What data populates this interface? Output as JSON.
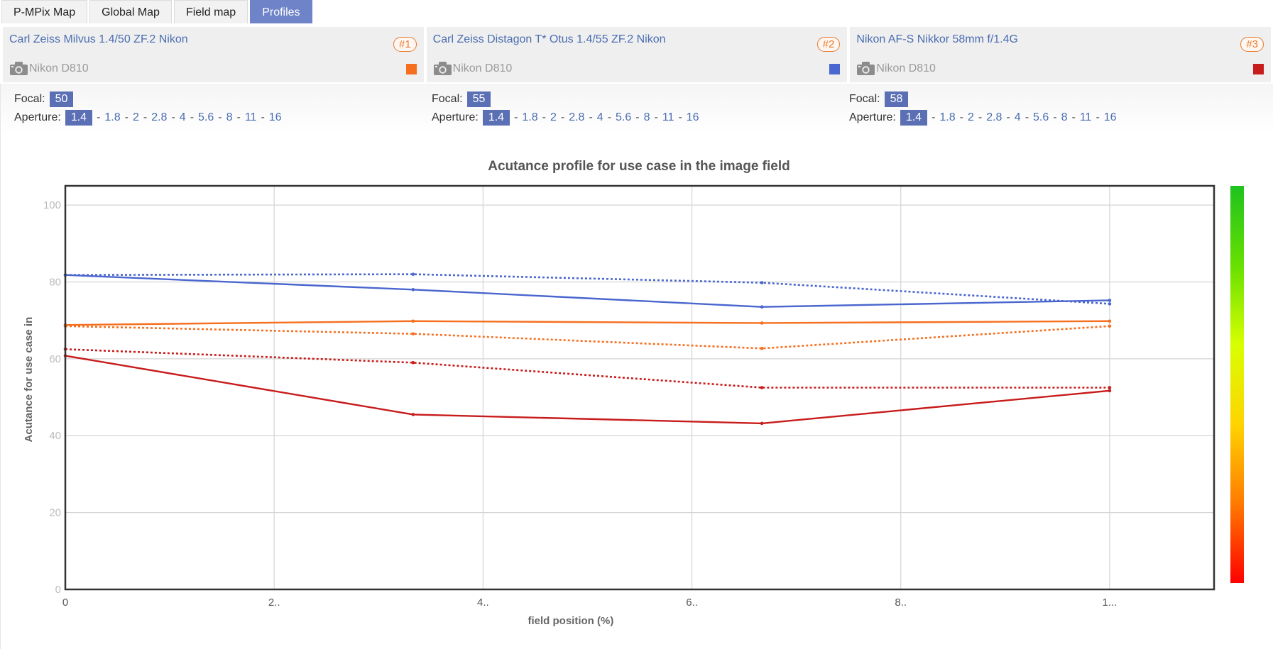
{
  "tabs": [
    {
      "label": "P-MPix Map",
      "active": false
    },
    {
      "label": "Global Map",
      "active": false
    },
    {
      "label": "Field map",
      "active": false
    },
    {
      "label": "Profiles",
      "active": true
    }
  ],
  "lenses": [
    {
      "name": "Carl Zeiss Milvus 1.4/50 ZF.2 Nikon",
      "badge": "#1",
      "camera": "Nikon D810",
      "color": "#f56f1f",
      "focal_label": "Focal:",
      "focal": "50",
      "aperture_label": "Aperture:",
      "aperture_selected": "1.4",
      "apertures": [
        "1.8",
        "2",
        "2.8",
        "4",
        "5.6",
        "8",
        "11",
        "16"
      ]
    },
    {
      "name": "Carl Zeiss Distagon T* Otus 1.4/55 ZF.2 Nikon",
      "badge": "#2",
      "camera": "Nikon D810",
      "color": "#4a66cf",
      "focal_label": "Focal:",
      "focal": "55",
      "aperture_label": "Aperture:",
      "aperture_selected": "1.4",
      "apertures": [
        "1.8",
        "2",
        "2.8",
        "4",
        "5.6",
        "8",
        "11",
        "16"
      ]
    },
    {
      "name": "Nikon AF-S Nikkor 58mm f/1.4G",
      "badge": "#3",
      "camera": "Nikon D810",
      "color": "#c81b1b",
      "focal_label": "Focal:",
      "focal": "58",
      "aperture_label": "Aperture:",
      "aperture_selected": "1.4",
      "apertures": [
        "1.8",
        "2",
        "2.8",
        "4",
        "5.6",
        "8",
        "11",
        "16"
      ]
    }
  ],
  "chart_data": {
    "type": "line",
    "title": "Acutance profile for use case in the image field",
    "xlabel": "field position (%)",
    "ylabel": "Acutance for use case in",
    "xlim": [
      0,
      110
    ],
    "ylim": [
      0,
      105
    ],
    "xticks": [
      0,
      20,
      40,
      60,
      80,
      100
    ],
    "xtick_labels": [
      "0",
      "2..",
      "4..",
      "6..",
      "8..",
      "1..."
    ],
    "yticks": [
      0,
      20,
      40,
      60,
      80,
      100
    ],
    "ytick_labels": [
      "0",
      "20",
      "40",
      "60",
      "80",
      "100"
    ],
    "grid": true,
    "x": [
      0,
      33.3,
      66.7,
      100
    ],
    "series": [
      {
        "color": "#4a66cf",
        "style": "solid",
        "values": [
          81.8,
          78,
          73.5,
          75.2
        ]
      },
      {
        "color": "#4a66cf",
        "style": "dotted",
        "values": [
          81.8,
          82,
          79.8,
          74.3
        ]
      },
      {
        "color": "#f56f1f",
        "style": "solid",
        "values": [
          68.8,
          69.8,
          69.3,
          69.8
        ]
      },
      {
        "color": "#f56f1f",
        "style": "dotted",
        "values": [
          68.5,
          66.5,
          62.7,
          68.5
        ]
      },
      {
        "color": "#c81b1b",
        "style": "dotted",
        "values": [
          62.5,
          59,
          52.5,
          52.5
        ]
      },
      {
        "color": "#c81b1b",
        "style": "solid",
        "values": [
          60.8,
          45.5,
          43.2,
          51.7
        ]
      }
    ],
    "colorbar": [
      "#ff0000",
      "#ff7a00",
      "#ffd400",
      "#d8ff00",
      "#66e000",
      "#1fc21f"
    ]
  }
}
